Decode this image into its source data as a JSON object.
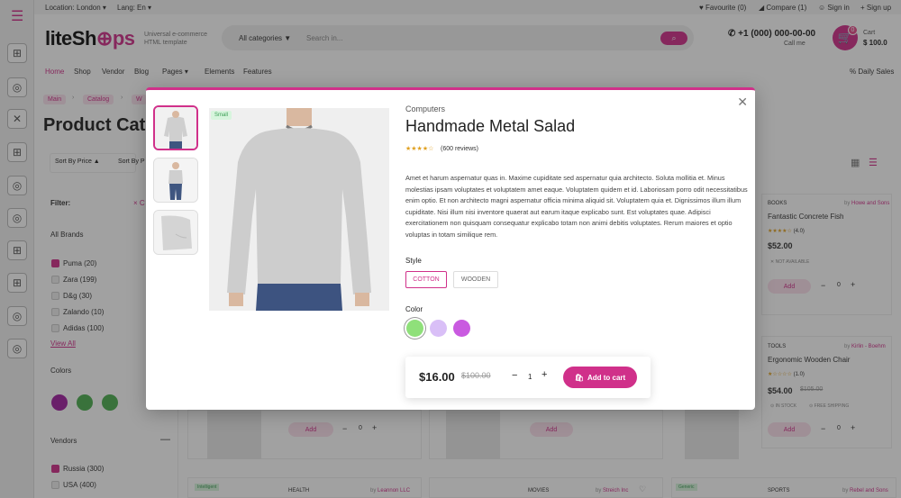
{
  "topbar": {
    "location": "Location:",
    "location_value": "London",
    "lang": "Lang:",
    "lang_value": "En",
    "favourite": "Favourite (0)",
    "compare": "Compare (1)",
    "signin": "Sign in",
    "signup": "Sign up"
  },
  "header": {
    "logo_part1": "liteSh",
    "logo_part2": "ps",
    "tagline": "Universal e-commerce HTML template",
    "search_category": "All categories",
    "search_placeholder": "Search in...",
    "phone": "+1 (000) 000-00-00",
    "call_me": "Call me",
    "cart_label": "Cart",
    "cart_count": "0",
    "cart_total": "$ 100.0"
  },
  "nav": {
    "items": [
      "Home",
      "Shop",
      "Vendor",
      "Blog",
      "Pages",
      "Elements",
      "Features"
    ],
    "daily_sales": "Daily Sales"
  },
  "breadcrumb": [
    "Main",
    "Catalog",
    "W"
  ],
  "page": {
    "title": "Product Cat",
    "sort_price": "Sort By Price",
    "sort_p": "Sort By P"
  },
  "filters": {
    "title": "Filter:",
    "clear": "C",
    "brands_title": "All Brands",
    "brands": [
      {
        "label": "Puma (20)",
        "checked": true
      },
      {
        "label": "Zara (199)",
        "checked": false
      },
      {
        "label": "D&g (30)",
        "checked": false
      },
      {
        "label": "Zalando (10)",
        "checked": false
      },
      {
        "label": "Adidas (100)",
        "checked": false
      }
    ],
    "view_all": "View All",
    "colors_title": "Colors",
    "colors": [
      "#a020a0",
      "#4caf50",
      "#4caf50"
    ],
    "vendors_title": "Vendors",
    "vendors": [
      {
        "label": "Russia (300)",
        "checked": true
      },
      {
        "label": "USA (400)",
        "checked": false
      }
    ]
  },
  "bg_products": [
    {
      "category": "BOOKS",
      "by": "by",
      "vendor": "Howe and Sons",
      "name": "Fantastic Concrete Fish",
      "rating": "(4.0)",
      "price": "$52.00",
      "status": "NOT AVAILABLE",
      "add": "Add",
      "qty": "0"
    },
    {
      "category": "TOOLS",
      "by": "by",
      "vendor": "Kirlin - Boehm",
      "name": "Ergonomic Wooden Chair",
      "rating": "(1.0)",
      "price": "$54.00",
      "old_price": "$105.00",
      "status": "IN STOCK",
      "shipping": "FREE SHIPPING",
      "add": "Add",
      "qty": "0"
    }
  ],
  "bg_row_adds": [
    {
      "add": "Add",
      "qty": "0"
    },
    {
      "add": "Add"
    },
    {
      "add": "Add",
      "qty": "0"
    }
  ],
  "bg_bottom": [
    {
      "badge": "Intelligent",
      "category": "HEALTH",
      "by": "by",
      "vendor": "Leannon LLC"
    },
    {
      "category": "MOVIES",
      "by": "by",
      "vendor": "Streich Inc"
    },
    {
      "badge": "Generic",
      "category": "SPORTS",
      "by": "by",
      "vendor": "Rebel and Sons"
    }
  ],
  "modal": {
    "category": "Computers",
    "title": "Handmade Metal Salad",
    "rating": 4,
    "reviews": "(600 reviews)",
    "badge": "Small",
    "description": "Amet et harum aspernatur quas in. Maxime cupiditate sed aspernatur quia architecto. Soluta mollitia et. Minus molestias ipsam voluptates et voluptatem amet eaque. Voluptatem quidem et id. Laboriosam porro odit necessitatibus enim optio. Et non architecto magni aspernatur officia minima aliquid sit. Voluptatem quia et. Dignissimos illum illum cupiditate. Nisi illum nisi inventore quaerat aut earum itaque explicabo sunt. Est voluptates quae. Adipisci exercitationem non quisquam consequatur explicabo totam non animi debitis voluptates. Rerum maiores et optio voluptas in totam similique rem.",
    "style_label": "Style",
    "styles": [
      {
        "label": "COTTON",
        "selected": true
      },
      {
        "label": "WOODEN",
        "selected": false
      }
    ],
    "color_label": "Color",
    "colors": [
      {
        "hex": "#8fe07a",
        "selected": true
      },
      {
        "hex": "#d9bff7",
        "selected": false
      },
      {
        "hex": "#c95ae0",
        "selected": false
      }
    ],
    "price": "$16.00",
    "old_price": "$100.00",
    "quantity": "1",
    "add_to_cart": "Add to cart"
  },
  "theme": {
    "accent": "#d0308a"
  }
}
